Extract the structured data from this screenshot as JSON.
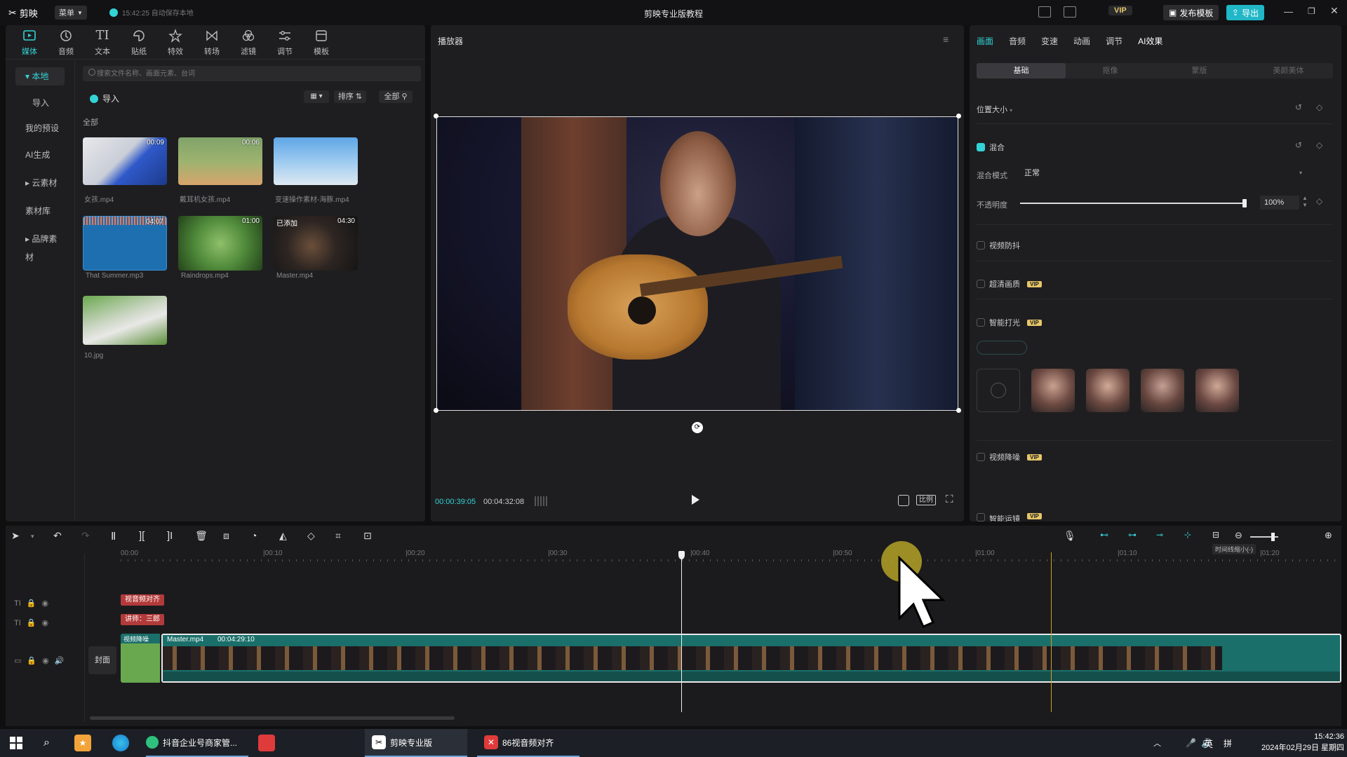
{
  "app": {
    "logo_text": "剪映",
    "menu_label": "菜单",
    "autosave_text": "15:42:25 自动保存本地",
    "title": "剪映专业版教程",
    "vip_label": "VIP",
    "publish_template": "发布模板",
    "export_label": "导出"
  },
  "toolbar": {
    "items": [
      {
        "label": "媒体",
        "icon": "media-icon"
      },
      {
        "label": "音频",
        "icon": "audio-icon"
      },
      {
        "label": "文本",
        "icon": "text-icon"
      },
      {
        "label": "贴纸",
        "icon": "sticker-icon"
      },
      {
        "label": "特效",
        "icon": "effects-icon"
      },
      {
        "label": "转场",
        "icon": "transition-icon"
      },
      {
        "label": "滤镜",
        "icon": "filter-icon"
      },
      {
        "label": "调节",
        "icon": "adjust-icon"
      },
      {
        "label": "模板",
        "icon": "template-icon"
      }
    ]
  },
  "sidebar": {
    "items": [
      {
        "label": "本地"
      },
      {
        "label": "导入"
      },
      {
        "label": "我的预设"
      },
      {
        "label": "AI生成"
      },
      {
        "label": "云素材"
      },
      {
        "label": "素材库"
      },
      {
        "label": "品牌素材"
      }
    ]
  },
  "media": {
    "search_placeholder": "搜索文件名称、画面元素、台词",
    "import_label": "导入",
    "sort_label": "排序",
    "filter_label": "全部",
    "section_label": "全部",
    "files": [
      {
        "name": "女孩.mp4",
        "duration": "00:09"
      },
      {
        "name": "戴耳机女孩.mp4",
        "duration": "00:06"
      },
      {
        "name": "变速操作素材-海豚.mp4",
        "duration": ""
      },
      {
        "name": "That Summer.mp3",
        "duration": "04:07"
      },
      {
        "name": "Raindrops.mp4",
        "duration": "01:00"
      },
      {
        "name": "Master.mp4",
        "duration": "04:30",
        "badge": "已添加"
      },
      {
        "name": "10.jpg",
        "duration": ""
      }
    ]
  },
  "player": {
    "title": "播放器",
    "current_time": "00:00:39:05",
    "total_time": "00:04:32:08",
    "ratio_label": "比例"
  },
  "props": {
    "tabs": [
      "画面",
      "音频",
      "变速",
      "动画",
      "调节",
      "AI效果"
    ],
    "subtabs": [
      "基础",
      "抠像",
      "蒙版",
      "美颜美体"
    ],
    "position_size": "位置大小",
    "blend": "混合",
    "blend_mode_label": "混合模式",
    "blend_mode_value": "正常",
    "opacity_label": "不透明度",
    "opacity_value": "100%",
    "opacity_fraction": 1.0,
    "stabilize": "视频防抖",
    "super_res": "超清画质",
    "smart_light": "智能打光",
    "denoise": "视频降噪",
    "motion_blur": "智能运镜",
    "vip_badge": "VIP"
  },
  "timeline": {
    "ticks": [
      "00:00",
      "|00:10",
      "|00:20",
      "|00:30",
      "|00:40",
      "|00:50",
      "|01:00",
      "|01:10",
      "|01:20"
    ],
    "zoom_tooltip": "时间线缩小(-)",
    "text_clip_1": "视音频对齐",
    "text_clip_2": "讲师：三郎",
    "cover_label": "封面",
    "video_track_tag": "视频降噪",
    "video_clip_name": "Master.mp4",
    "video_clip_duration": "00:04:29:10"
  },
  "taskbar": {
    "app1": "抖音企业号商家管...",
    "app2": "剪映专业版",
    "app3": "86视音频对齐",
    "ime": "英",
    "ime2": "拼",
    "time": "15:42:36",
    "date": "2024年02月29日 星期四"
  },
  "colors": {
    "accent": "#33d3d6",
    "vip": "#e6c76a",
    "clip": "#1a6f6a",
    "text_clip": "#b33a3a"
  }
}
